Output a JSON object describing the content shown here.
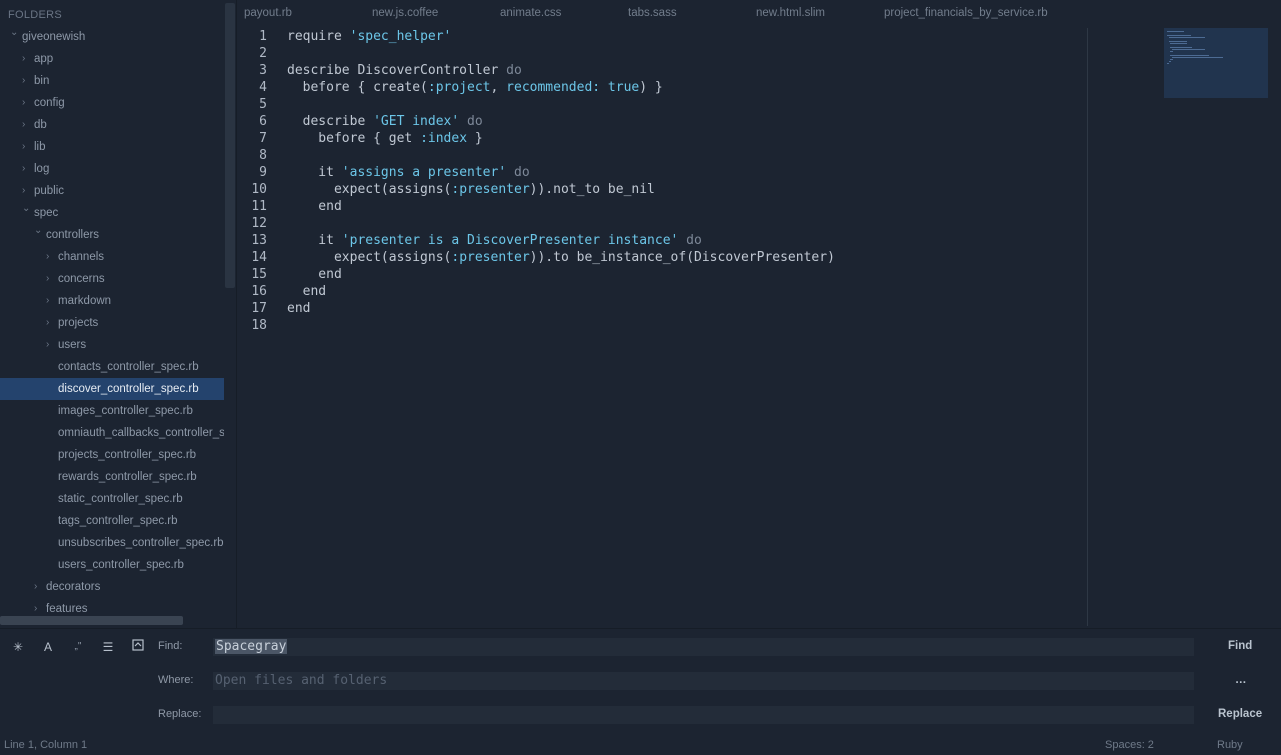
{
  "sidebar": {
    "header": "FOLDERS",
    "items": [
      {
        "label": "giveonewish",
        "depth": 0,
        "arrow": "down"
      },
      {
        "label": "app",
        "depth": 1,
        "arrow": "right"
      },
      {
        "label": "bin",
        "depth": 1,
        "arrow": "right"
      },
      {
        "label": "config",
        "depth": 1,
        "arrow": "right"
      },
      {
        "label": "db",
        "depth": 1,
        "arrow": "right"
      },
      {
        "label": "lib",
        "depth": 1,
        "arrow": "right"
      },
      {
        "label": "log",
        "depth": 1,
        "arrow": "right"
      },
      {
        "label": "public",
        "depth": 1,
        "arrow": "right"
      },
      {
        "label": "spec",
        "depth": 1,
        "arrow": "down"
      },
      {
        "label": "controllers",
        "depth": 2,
        "arrow": "down"
      },
      {
        "label": "channels",
        "depth": 3,
        "arrow": "right"
      },
      {
        "label": "concerns",
        "depth": 3,
        "arrow": "right"
      },
      {
        "label": "markdown",
        "depth": 3,
        "arrow": "right"
      },
      {
        "label": "projects",
        "depth": 3,
        "arrow": "right"
      },
      {
        "label": "users",
        "depth": 3,
        "arrow": "right"
      },
      {
        "label": "contacts_controller_spec.rb",
        "depth": 3,
        "arrow": "none"
      },
      {
        "label": "discover_controller_spec.rb",
        "depth": 3,
        "arrow": "none",
        "selected": true
      },
      {
        "label": "images_controller_spec.rb",
        "depth": 3,
        "arrow": "none"
      },
      {
        "label": "omniauth_callbacks_controller_spec.rb",
        "depth": 3,
        "arrow": "none"
      },
      {
        "label": "projects_controller_spec.rb",
        "depth": 3,
        "arrow": "none"
      },
      {
        "label": "rewards_controller_spec.rb",
        "depth": 3,
        "arrow": "none"
      },
      {
        "label": "static_controller_spec.rb",
        "depth": 3,
        "arrow": "none"
      },
      {
        "label": "tags_controller_spec.rb",
        "depth": 3,
        "arrow": "none"
      },
      {
        "label": "unsubscribes_controller_spec.rb",
        "depth": 3,
        "arrow": "none"
      },
      {
        "label": "users_controller_spec.rb",
        "depth": 3,
        "arrow": "none"
      },
      {
        "label": "decorators",
        "depth": 2,
        "arrow": "right"
      },
      {
        "label": "features",
        "depth": 2,
        "arrow": "right"
      }
    ]
  },
  "tabs": [
    "payout.rb",
    "new.js.coffee",
    "animate.css",
    "tabs.sass",
    "new.html.slim",
    "project_financials_by_service.rb"
  ],
  "editor": {
    "language": "Ruby",
    "lines": [
      [
        [
          "t",
          "require "
        ],
        [
          "s",
          "'spec_helper'"
        ]
      ],
      [],
      [
        [
          "t",
          "describe DiscoverController "
        ],
        [
          "k",
          "do"
        ]
      ],
      [
        [
          "t",
          "  before { create("
        ],
        [
          "y",
          ":project"
        ],
        [
          "t",
          ", "
        ],
        [
          "y",
          "recommended:"
        ],
        [
          "t",
          " "
        ],
        [
          "s",
          "true"
        ],
        [
          "t",
          ") }"
        ]
      ],
      [],
      [
        [
          "t",
          "  describe "
        ],
        [
          "s",
          "'GET index'"
        ],
        [
          "t",
          " "
        ],
        [
          "k",
          "do"
        ]
      ],
      [
        [
          "t",
          "    before { get "
        ],
        [
          "y",
          ":index"
        ],
        [
          "t",
          " }"
        ]
      ],
      [],
      [
        [
          "t",
          "    it "
        ],
        [
          "s",
          "'assigns a presenter'"
        ],
        [
          "t",
          " "
        ],
        [
          "k",
          "do"
        ]
      ],
      [
        [
          "t",
          "      expect(assigns("
        ],
        [
          "y",
          ":presenter"
        ],
        [
          "t",
          ")).not_to be_nil"
        ]
      ],
      [
        [
          "t",
          "    end"
        ]
      ],
      [],
      [
        [
          "t",
          "    it "
        ],
        [
          "s",
          "'presenter is a DiscoverPresenter instance'"
        ],
        [
          "t",
          " "
        ],
        [
          "k",
          "do"
        ]
      ],
      [
        [
          "t",
          "      expect(assigns("
        ],
        [
          "y",
          ":presenter"
        ],
        [
          "t",
          ")).to be_instance_of(DiscoverPresenter)"
        ]
      ],
      [
        [
          "t",
          "    end"
        ]
      ],
      [
        [
          "t",
          "  end"
        ]
      ],
      [
        [
          "t",
          "end"
        ]
      ],
      []
    ]
  },
  "find_panel": {
    "find_label": "Find:",
    "find_value": "Spacegray",
    "where_label": "Where:",
    "where_placeholder": "Open files and folders",
    "replace_label": "Replace:",
    "replace_value": "",
    "find_button": "Find",
    "where_button": "…",
    "replace_button": "Replace",
    "option_icons": [
      "regex-icon",
      "case-sensitive-icon",
      "whole-word-icon",
      "in-selection-icon",
      "show-context-icon"
    ]
  },
  "status": {
    "position": "Line 1, Column 1",
    "spaces": "Spaces: 2",
    "syntax": "Ruby"
  },
  "colors": {
    "background": "#1c2431",
    "selection": "#24436d",
    "string": "#6cc6e8",
    "keyword": "#7d8898"
  }
}
